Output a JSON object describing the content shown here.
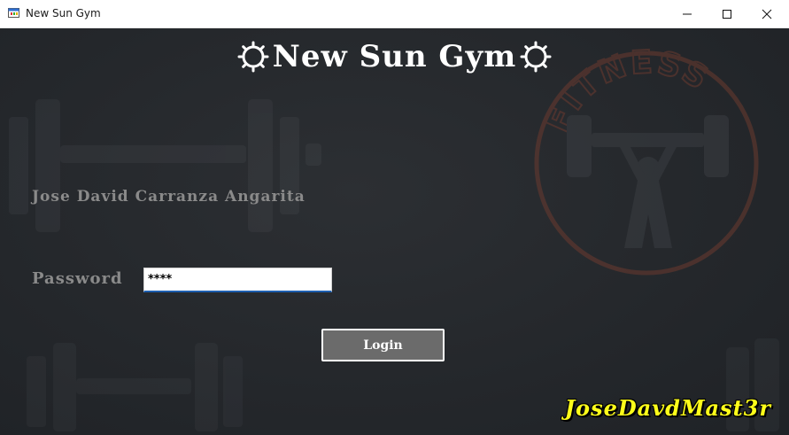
{
  "window": {
    "title": "New Sun Gym",
    "controls": [
      "minimize-icon",
      "maximize-icon",
      "close-icon"
    ]
  },
  "header": {
    "title": "New Sun Gym",
    "decor_icon": "sun-icon"
  },
  "background": {
    "emblem_text": "FITNESS",
    "emblem_icon": "weightlifter-icon",
    "decor_icon": "dumbbell-icon"
  },
  "user": {
    "name": "Jose David Carranza Angarita"
  },
  "login": {
    "password_label": "Password",
    "password_value": "****",
    "button_label": "Login"
  },
  "footer": {
    "signature": "JoseDavdMast3r"
  },
  "colors": {
    "background": "#24272b",
    "signature": "#ffff1a",
    "button": "#6b6b6b",
    "emblem": "#6b3a2f",
    "input_focus": "#1e5fb0"
  }
}
